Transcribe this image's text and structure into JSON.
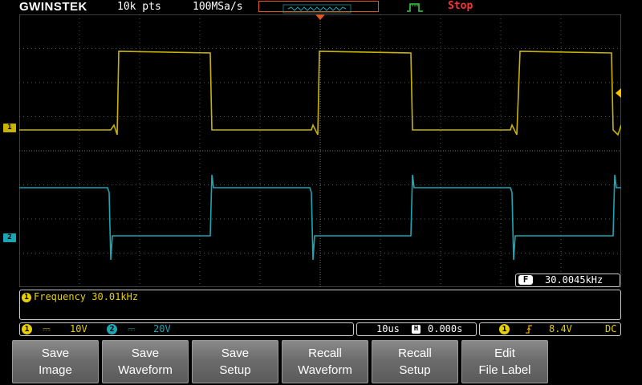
{
  "header": {
    "brand": "GWINSTEK",
    "record_length": "10k pts",
    "sample_rate": "100MSa/s",
    "run_state": "Stop",
    "run_state_color": "#ff3030"
  },
  "channels": [
    {
      "id": "1",
      "label": "1",
      "color": "#c8b400",
      "scale": "10V",
      "coupling_icon": "dc-coupling-icon"
    },
    {
      "id": "2",
      "label": "2",
      "color": "#1aa6b4",
      "scale": "20V",
      "coupling_icon": "dc-coupling-icon"
    }
  ],
  "frequency_counter": {
    "badge": "F",
    "value": "30.0045kHz"
  },
  "measurement": {
    "index": "1",
    "text": "Frequency 30.01kHz"
  },
  "status": {
    "ch1_index": "1",
    "ch1_scale": "10V",
    "ch2_index": "2",
    "ch2_scale": "20V",
    "timebase": "10us",
    "h_badge": "H",
    "h_position": "0.000s",
    "trigger_source_index": "1",
    "trigger_level": "8.4V",
    "trigger_coupling": "DC"
  },
  "softkeys": [
    {
      "line1": "Save",
      "line2": "Image"
    },
    {
      "line1": "Save",
      "line2": "Waveform"
    },
    {
      "line1": "Save",
      "line2": "Setup"
    },
    {
      "line1": "Recall",
      "line2": "Waveform"
    },
    {
      "line1": "Recall",
      "line2": "Setup"
    },
    {
      "line1": "Edit",
      "line2": "File Label"
    }
  ],
  "colors": {
    "ch1": "#c8b400",
    "ch2": "#1aa6b4",
    "accent_orange": "#e05a20",
    "trigger_marker": "#ffc000"
  }
}
